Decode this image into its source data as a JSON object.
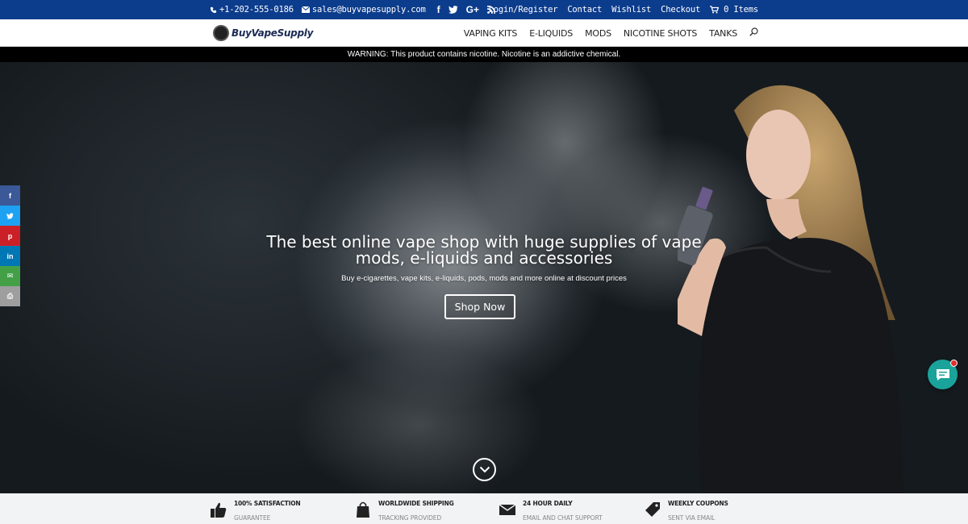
{
  "topbar": {
    "phone": "+1-202-555-0186",
    "email": "sales@buyvapesupply.com",
    "social": [
      "f",
      "G+"
    ],
    "links": [
      "Login/Register",
      "Contact",
      "Wishlist",
      "Checkout"
    ],
    "cart": "0 Items",
    "bg_color": "#0c3c8c"
  },
  "header": {
    "logo_text": "BuyVapeSupply",
    "nav": [
      "VAPING KITS",
      "E-LIQUIDS",
      "MODS",
      "NICOTINE SHOTS",
      "TANKS"
    ]
  },
  "warning": "WARNING: This product contains nicotine. Nicotine is an addictive chemical.",
  "hero": {
    "title_line1": "The best online vape shop with huge supplies of vape",
    "title_line2": "mods, e-liquids and accessories",
    "subtitle": "Buy e-cigarettes, vape kits, e-liquids, pods, mods and more online at discount prices",
    "button": "Shop Now"
  },
  "social_sidebar": [
    {
      "label": "f",
      "icon": "facebook-icon",
      "color": "#3b5998"
    },
    {
      "label": "t",
      "icon": "twitter-icon",
      "color": "#1da1f2"
    },
    {
      "label": "p",
      "icon": "pinterest-icon",
      "color": "#cb2027"
    },
    {
      "label": "in",
      "icon": "linkedin-icon",
      "color": "#0077b5"
    },
    {
      "label": "✉",
      "icon": "email-icon",
      "color": "#43a047"
    },
    {
      "label": "⎙",
      "icon": "print-icon",
      "color": "#9e9e9e"
    }
  ],
  "features": [
    {
      "title": "100% SATISFACTION",
      "sub": "GUARANTEE",
      "icon": "thumbs-up-icon"
    },
    {
      "title": "WORLDWIDE SHIPPING",
      "sub": "TRACKING PROVIDED",
      "icon": "shopping-bag-icon"
    },
    {
      "title": "24 HOUR DAILY",
      "sub": "EMAIL AND CHAT SUPPORT",
      "icon": "envelope-icon"
    },
    {
      "title": "WEEKLY COUPONS",
      "sub": "SENT VIA EMAIL",
      "icon": "tag-icon"
    }
  ]
}
